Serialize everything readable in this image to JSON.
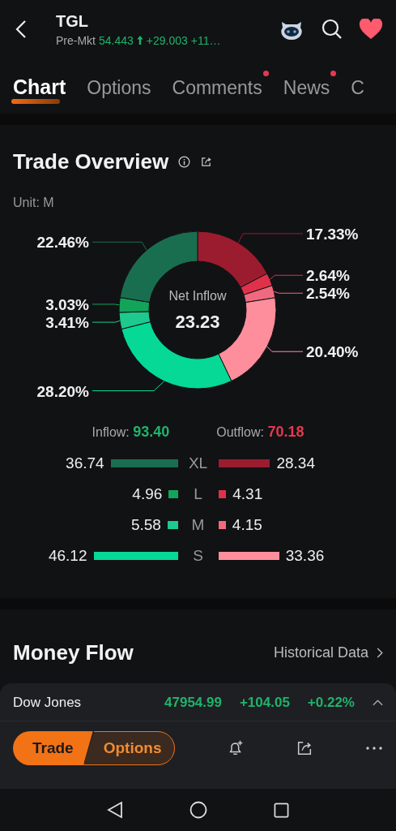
{
  "header": {
    "symbol": "TGL",
    "session": "Pre-Mkt",
    "price": "54.443",
    "change": "+29.003",
    "change_pct": "+11…",
    "favorited": true
  },
  "tabs": [
    {
      "label": "Chart",
      "selected": true,
      "has_dot": false
    },
    {
      "label": "Options",
      "selected": false,
      "has_dot": false
    },
    {
      "label": "Comments",
      "selected": false,
      "has_dot": true
    },
    {
      "label": "News",
      "selected": false,
      "has_dot": true
    },
    {
      "label": "C",
      "selected": false,
      "has_dot": false
    }
  ],
  "trade_overview": {
    "title": "Trade Overview",
    "unit": "Unit: M",
    "center_label": "Net Inflow",
    "center_value": "23.23",
    "chart_data": {
      "type": "donut",
      "values": [
        17.33,
        2.64,
        2.54,
        20.4,
        28.2,
        3.41,
        3.03,
        22.46
      ],
      "value_labels": [
        "17.33%",
        "2.64%",
        "2.54%",
        "20.40%",
        "28.20%",
        "3.41%",
        "3.03%",
        "22.46%"
      ],
      "colors": [
        "#9b1c2e",
        "#e0314b",
        "#f06a7f",
        "#ff8e9c",
        "#05d995",
        "#1ec98e",
        "#12a55a",
        "#1a6e50"
      ],
      "data_labels": true
    },
    "inflow_label": "Inflow:",
    "inflow_total": "93.40",
    "outflow_label": "Outflow:",
    "outflow_total": "70.18",
    "rows": [
      {
        "size": "XL",
        "inflow": "36.74",
        "outflow": "28.34"
      },
      {
        "size": "L",
        "inflow": "4.96",
        "outflow": "4.31"
      },
      {
        "size": "M",
        "inflow": "5.58",
        "outflow": "4.15"
      },
      {
        "size": "S",
        "inflow": "46.12",
        "outflow": "33.36"
      }
    ]
  },
  "money_flow": {
    "title": "Money Flow",
    "link": "Historical Data"
  },
  "ticker": {
    "name": "Dow Jones",
    "price": "47954.99",
    "change": "+104.05",
    "change_pct": "+0.22%"
  },
  "actions": {
    "trade": "Trade",
    "options": "Options"
  }
}
